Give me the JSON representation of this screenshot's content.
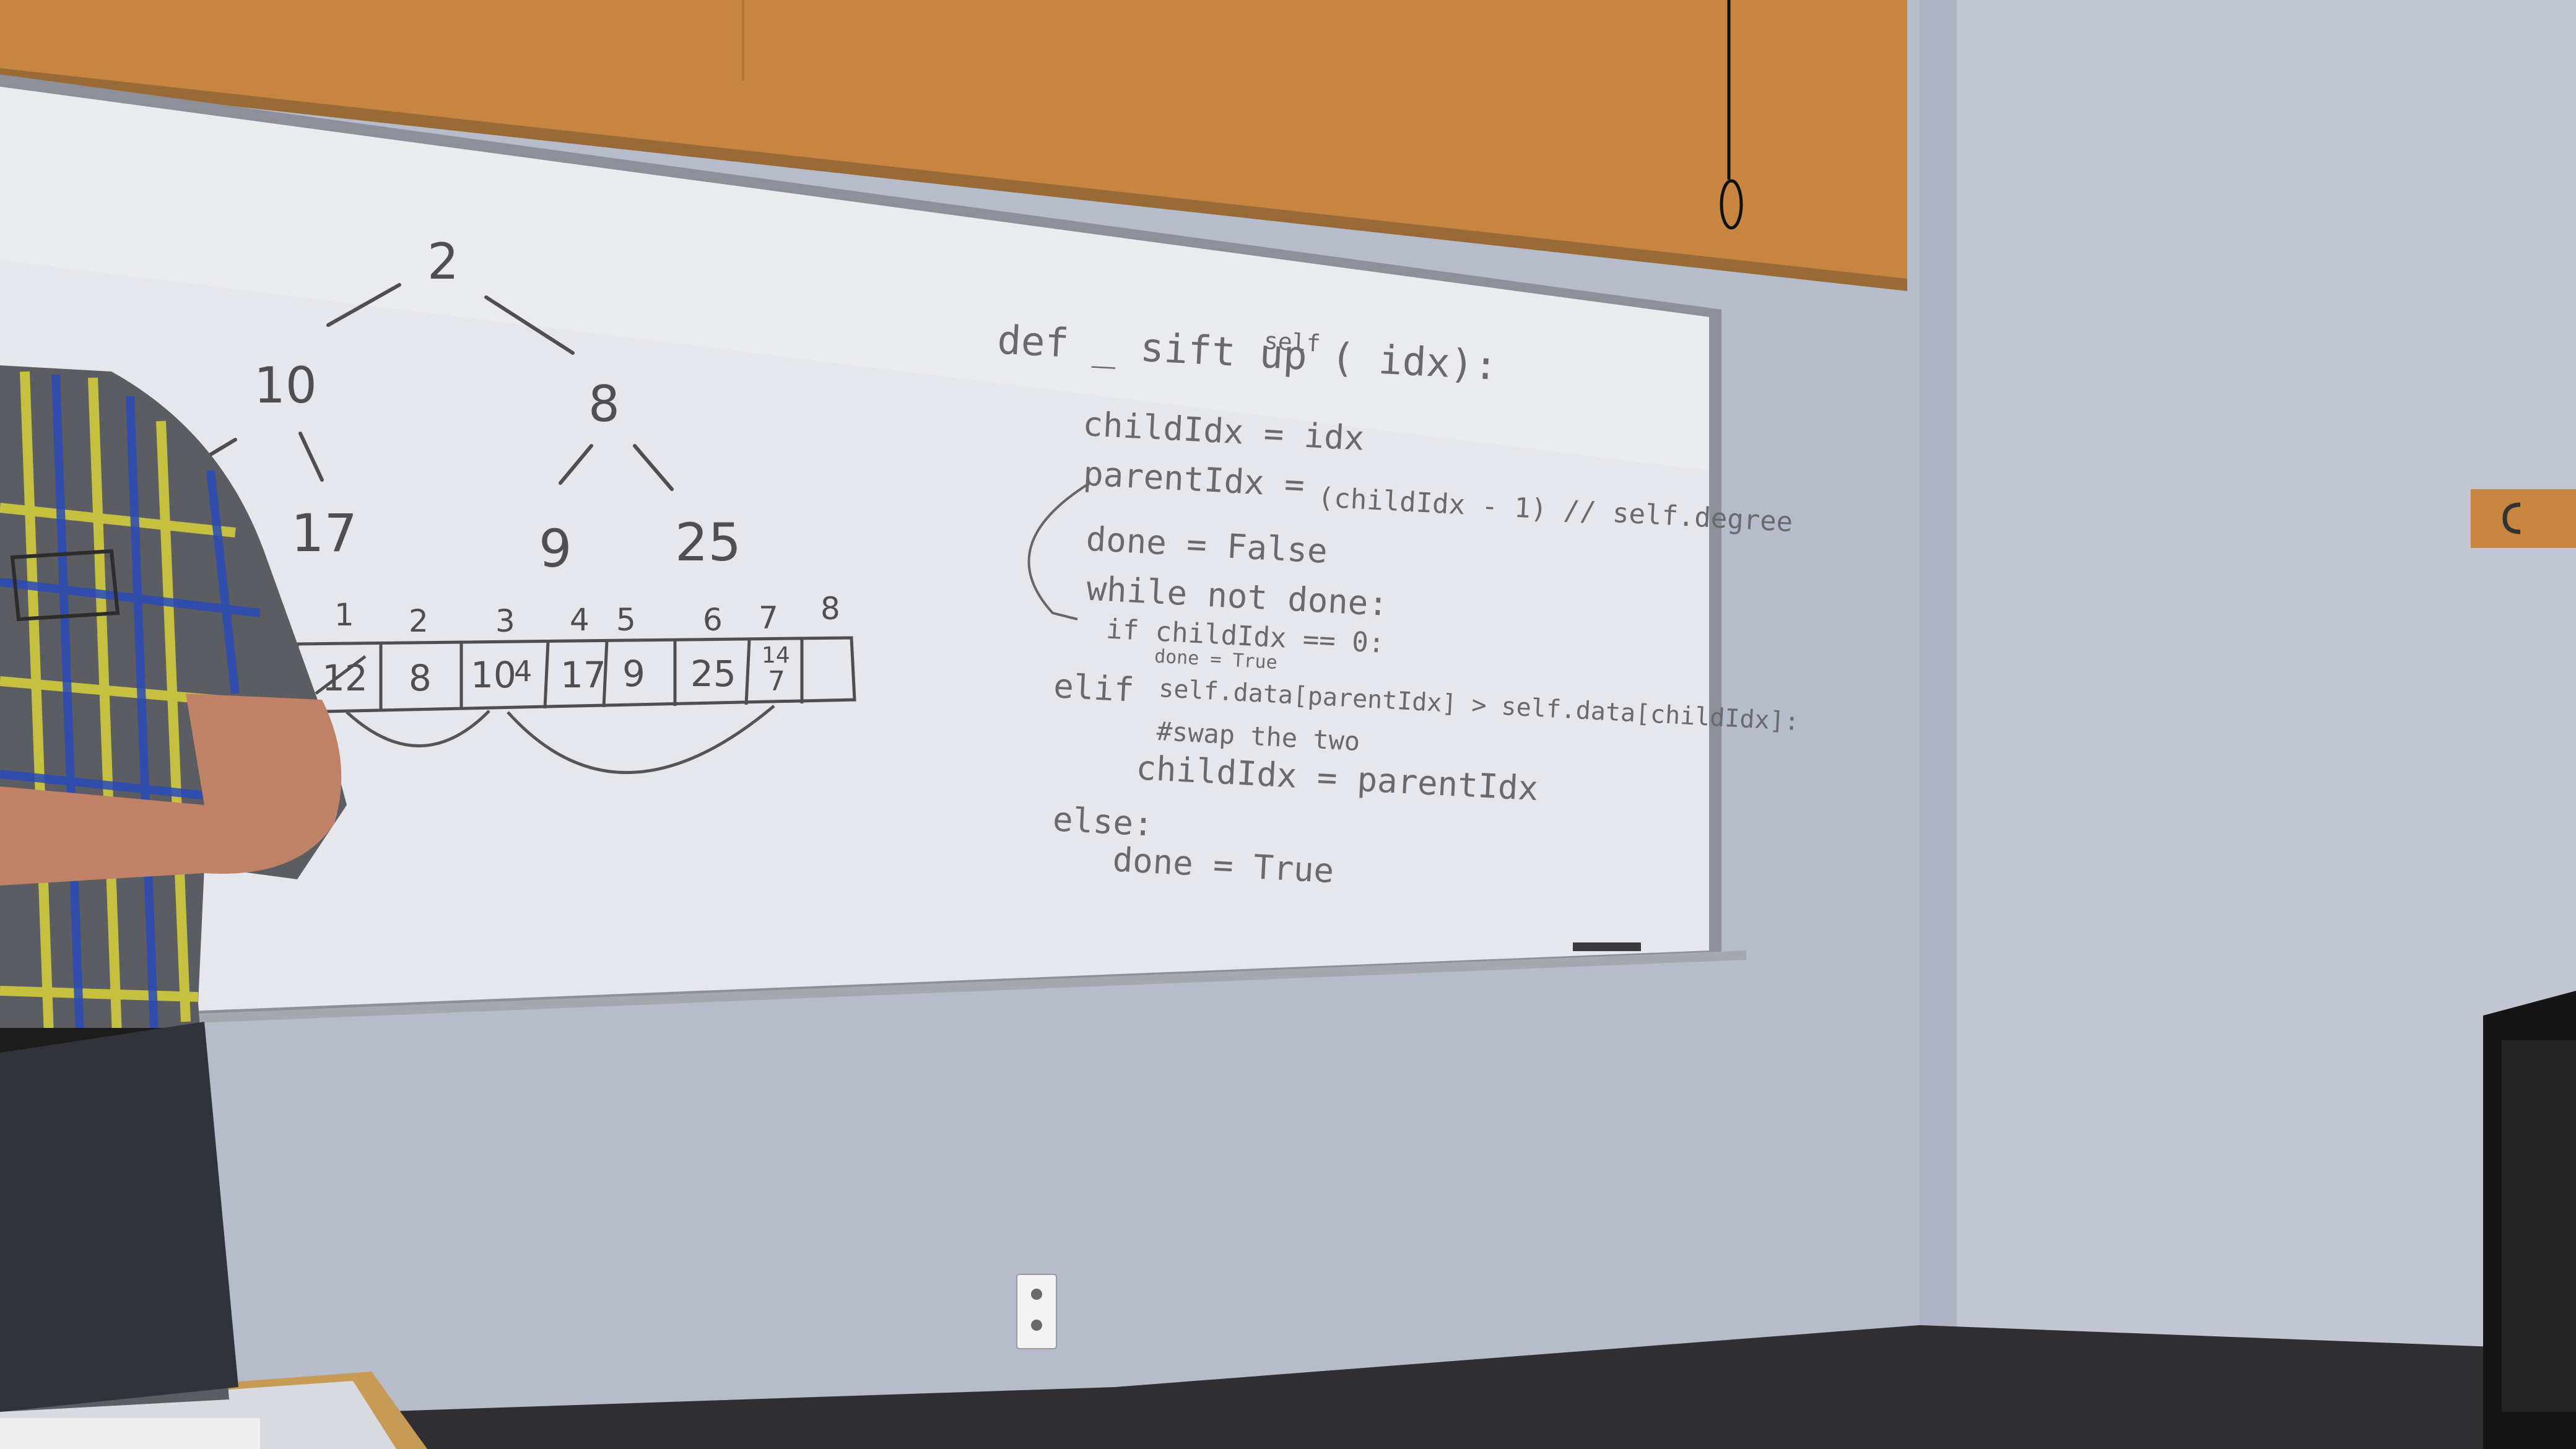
{
  "scene": {
    "description_labels": {
      "room": "classroom",
      "board": "whiteboard"
    }
  },
  "whiteboard": {
    "tree": {
      "root": "2",
      "level1_left": "10",
      "level1_right": "8",
      "level2_a": "17",
      "level2_b": "9",
      "level2_c": "25"
    },
    "array": {
      "indices": [
        "1",
        "2",
        "3",
        "4",
        "5",
        "6",
        "7",
        "8"
      ],
      "cells": [
        "12",
        "8",
        "10",
        "4",
        "17",
        "9",
        "25",
        "14",
        "7",
        ""
      ]
    },
    "code": {
      "line1": "def _ sift up ( idx):",
      "line1_insert": "self",
      "line2": "childIdx = idx",
      "line3": "parentIdx =",
      "line3_expr": "(childIdx - 1) // self.degree",
      "line4": "done = False",
      "line5": "while not done:",
      "line6": "if childIdx == 0:",
      "line7": "done = True",
      "line8": "elif",
      "line8_expr": "self.data[parentIdx] > self.data[childIdx]:",
      "line9": "#swap the two",
      "line10": "childIdx = parentIdx",
      "line11": "else:",
      "line12": "done = True"
    }
  },
  "colors": {
    "wall": "#b7bccb",
    "board": "#e6e7ec",
    "shelf": "#d08a3e",
    "ink": "#4f4f52"
  }
}
